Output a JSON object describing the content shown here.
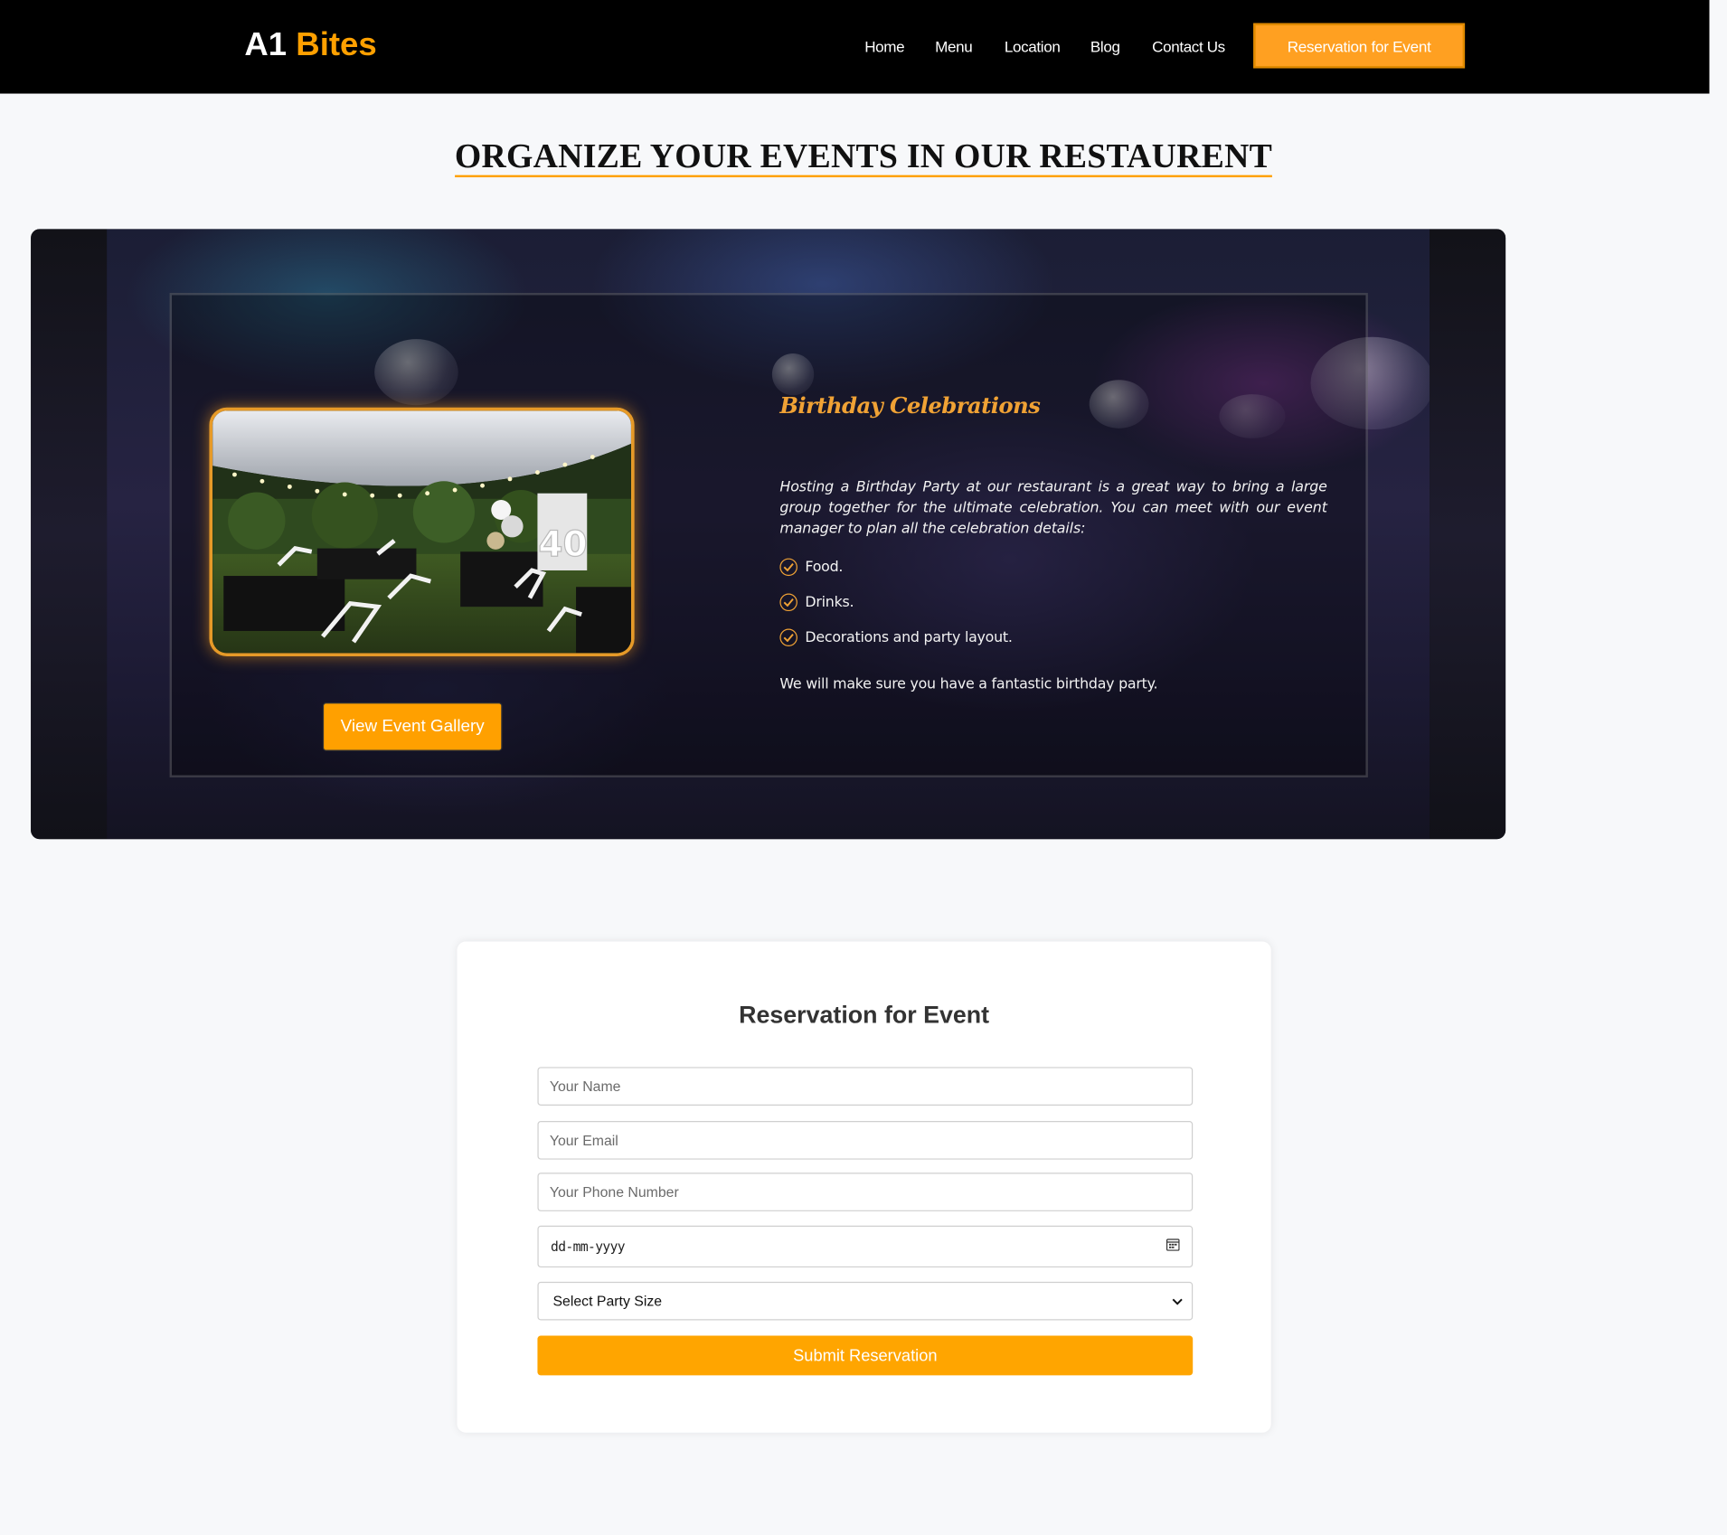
{
  "nav": {
    "logo_main": "A1",
    "logo_accent": "Bites",
    "links": [
      "Home",
      "Menu",
      "Location",
      "Blog",
      "Contact Us"
    ],
    "cta": "Reservation for Event"
  },
  "page": {
    "title": "ORGANIZE YOUR EVENTS IN OUR RESTAURENT"
  },
  "hero": {
    "heading": "Birthday Celebrations",
    "paragraph": "Hosting a Birthday Party at our restaurant is a great way to bring a large group together for the ultimate celebration. You can meet with our event manager to plan all the celebration details:",
    "list": [
      "Food.",
      "Drinks.",
      "Decorations and party layout."
    ],
    "closing": "We will make sure you have a fantastic birthday party.",
    "gallery_button": "View Event Gallery",
    "photo_number": "40"
  },
  "form": {
    "title": "Reservation for Event",
    "name_placeholder": "Your Name",
    "email_placeholder": "Your Email",
    "phone_placeholder": "Your Phone Number",
    "date_placeholder": "dd-mm-yyyy",
    "party_size": "Select Party Size",
    "submit": "Submit Reservation"
  },
  "colors": {
    "accent": "#ffa000",
    "nav_bg": "#000000",
    "page_bg": "#f7f8fa"
  }
}
